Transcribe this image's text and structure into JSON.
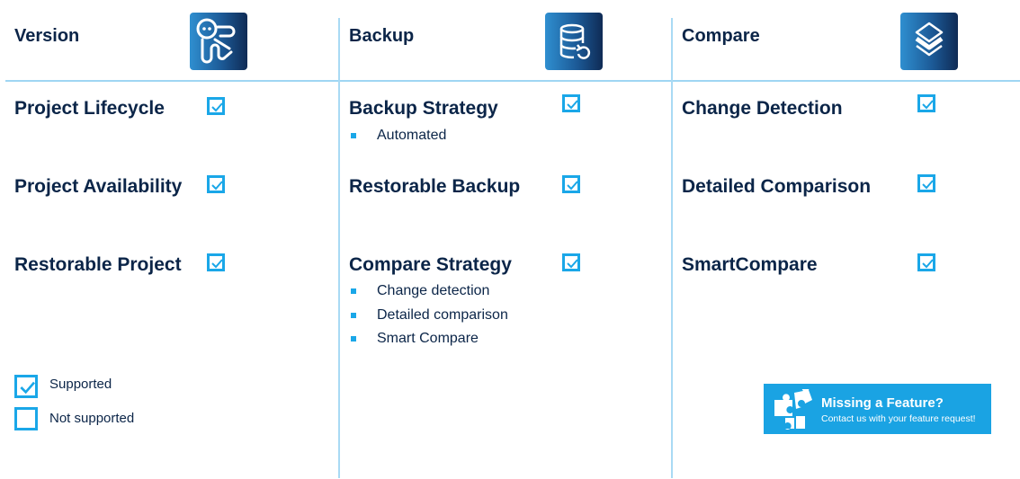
{
  "columns": [
    {
      "title": "Version",
      "icon": "octopus-logo-icon",
      "features": [
        {
          "label": "Project Lifecycle",
          "supported": true,
          "subitems": []
        },
        {
          "label": "Project Availability",
          "supported": true,
          "subitems": []
        },
        {
          "label": "Restorable Project",
          "supported": true,
          "subitems": []
        }
      ]
    },
    {
      "title": "Backup",
      "icon": "database-restore-icon",
      "features": [
        {
          "label": "Backup Strategy",
          "supported": true,
          "subitems": [
            "Automated"
          ]
        },
        {
          "label": "Restorable Backup",
          "supported": true,
          "subitems": []
        },
        {
          "label": "Compare Strategy",
          "supported": true,
          "subitems": [
            "Change detection",
            "Detailed comparison",
            "Smart Compare"
          ]
        }
      ]
    },
    {
      "title": "Compare",
      "icon": "layers-icon",
      "features": [
        {
          "label": "Change Detection",
          "supported": true,
          "subitems": []
        },
        {
          "label": "Detailed Comparison",
          "supported": true,
          "subitems": []
        },
        {
          "label": "SmartCompare",
          "supported": true,
          "subitems": []
        }
      ]
    }
  ],
  "legend": {
    "supported": "Supported",
    "not_supported": "Not supported"
  },
  "banner": {
    "icon": "puzzle-pieces-icon",
    "title": "Missing a Feature?",
    "subtitle": "Contact us with your feature request!"
  },
  "colors": {
    "accent": "#1aa7e8",
    "text": "#0b2548",
    "divider": "#a9daf4",
    "banner": "#1aa3e3"
  }
}
